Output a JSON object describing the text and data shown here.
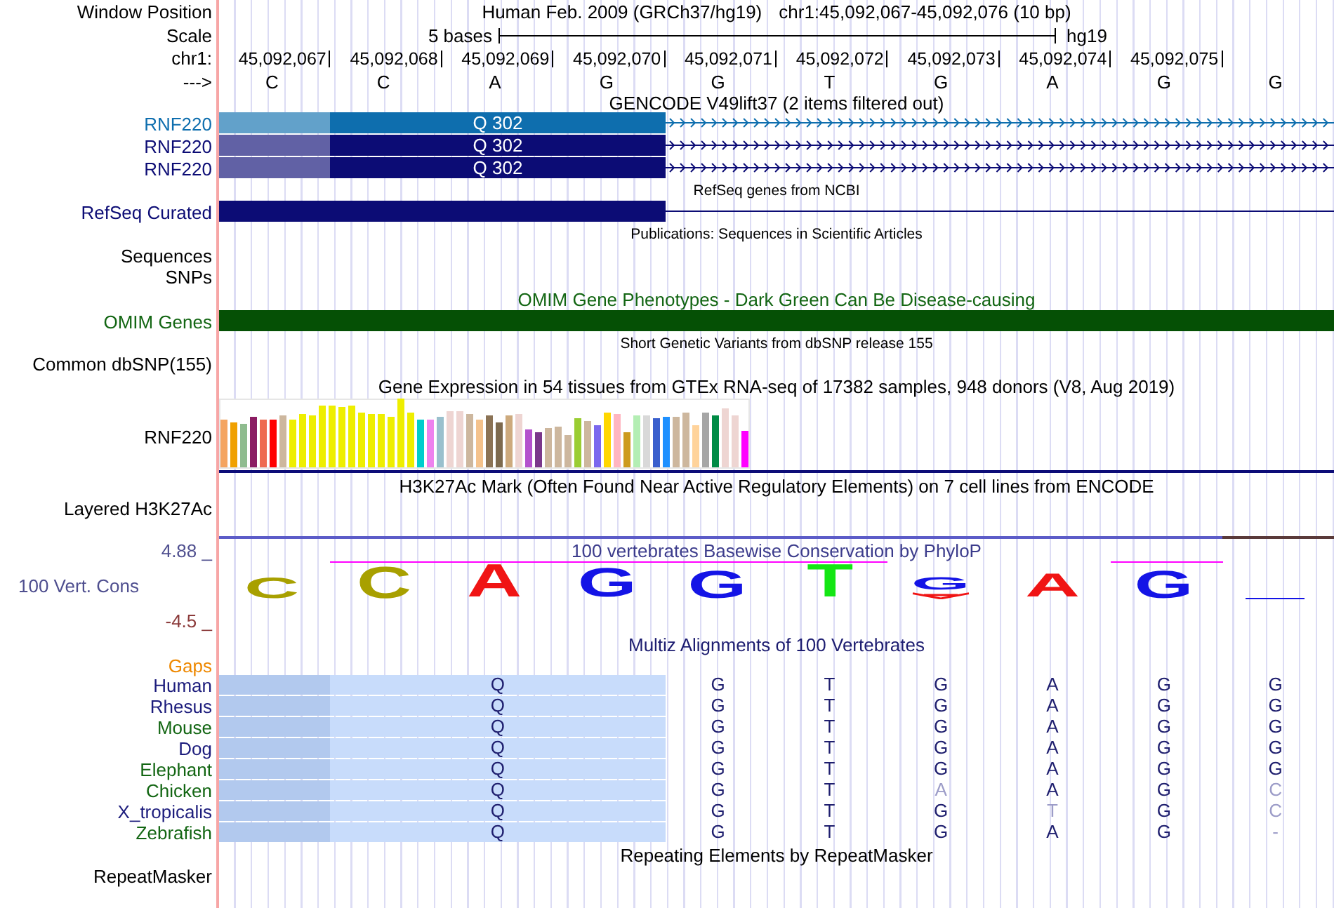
{
  "window_position": {
    "label": "Window Position",
    "assembly": "Human Feb. 2009 (GRCh37/hg19)",
    "position": "chr1:45,092,067-45,092,076 (10 bp)"
  },
  "scale": {
    "label": "Scale",
    "span": "5 bases",
    "assembly": "hg19"
  },
  "coordinates": {
    "label": "chr1:",
    "positions": [
      "45,092,067",
      "45,092,068",
      "45,092,069",
      "45,092,070",
      "45,092,071",
      "45,092,072",
      "45,092,073",
      "45,092,074",
      "45,092,075"
    ]
  },
  "sequence": {
    "label": "--->",
    "bases": [
      "C",
      "C",
      "A",
      "G",
      "G",
      "T",
      "G",
      "A",
      "G",
      "G"
    ]
  },
  "gencode": {
    "title": "GENCODE V49lift37 (2 items filtered out)",
    "rows": [
      {
        "label": "RNF220",
        "color": "#0e6eae",
        "codon": "Q 302"
      },
      {
        "label": "RNF220",
        "color": "#0c0c75",
        "codon": "Q 302"
      },
      {
        "label": "RNF220",
        "color": "#0c0c75",
        "codon": "Q 302"
      }
    ]
  },
  "refseq": {
    "title": "RefSeq genes from NCBI",
    "label": "RefSeq Curated",
    "color": "#0c0c75"
  },
  "publications": {
    "title": "Publications: Sequences in Scientific Articles",
    "subtracks": [
      "Sequences",
      "SNPs"
    ]
  },
  "omim": {
    "title": "OMIM Gene Phenotypes - Dark Green Can Be Disease-causing",
    "label": "OMIM Genes"
  },
  "dbsnp": {
    "title": "Short Genetic Variants from dbSNP release 155",
    "label": "Common dbSNP(155)"
  },
  "gtex": {
    "title": "Gene Expression in 54 tissues from GTEx RNA-seq of 17382 samples, 948 donors (V8, Aug 2019)",
    "label": "RNF220"
  },
  "h3k27ac": {
    "title": "H3K27Ac Mark (Often Found Near Active Regulatory Elements) on 7 cell lines from ENCODE",
    "label": "Layered H3K27Ac"
  },
  "conservation": {
    "title": "100 vertebrates Basewise Conservation by PhyloP",
    "label": "100 Vert. Cons",
    "max_label": "4.88 _",
    "min_label": "-4.5 _",
    "logo": [
      {
        "kind": "letter",
        "base": "C",
        "color": "#a8a000"
      },
      {
        "kind": "letter",
        "base": "C",
        "color": "#a8a000"
      },
      {
        "kind": "letter",
        "base": "A",
        "color": "#f01414"
      },
      {
        "kind": "letter",
        "base": "G",
        "color": "#1414e6"
      },
      {
        "kind": "letter",
        "base": "G",
        "color": "#1414e6"
      },
      {
        "kind": "letter",
        "base": "T",
        "color": "#14e614"
      },
      {
        "kind": "letter",
        "base": "G",
        "color": "#1414e6",
        "below": {
          "color": "#f01414"
        }
      },
      {
        "kind": "letter",
        "base": "A",
        "color": "#f01414"
      },
      {
        "kind": "letter",
        "base": "G",
        "color": "#1414e6"
      },
      {
        "kind": "dash",
        "color": "#1414e6"
      }
    ]
  },
  "multiz": {
    "title": "Multiz Alignments of 100 Vertebrates",
    "gaps_label": "Gaps",
    "species": [
      {
        "name": "Human",
        "color": "#1c1c7c",
        "codon": "Q",
        "bases": [
          {
            "base": "G",
            "match": true
          },
          {
            "base": "T",
            "match": true
          },
          {
            "base": "G",
            "match": true
          },
          {
            "base": "A",
            "match": true
          },
          {
            "base": "G",
            "match": true
          },
          {
            "base": "G",
            "match": true
          }
        ]
      },
      {
        "name": "Rhesus",
        "color": "#1c1c7c",
        "codon": "Q",
        "bases": [
          {
            "base": "G",
            "match": true
          },
          {
            "base": "T",
            "match": true
          },
          {
            "base": "G",
            "match": true
          },
          {
            "base": "A",
            "match": true
          },
          {
            "base": "G",
            "match": true
          },
          {
            "base": "G",
            "match": true
          }
        ]
      },
      {
        "name": "Mouse",
        "color": "#136613",
        "codon": "Q",
        "bases": [
          {
            "base": "G",
            "match": true
          },
          {
            "base": "T",
            "match": true
          },
          {
            "base": "G",
            "match": true
          },
          {
            "base": "A",
            "match": true
          },
          {
            "base": "G",
            "match": true
          },
          {
            "base": "G",
            "match": true
          }
        ]
      },
      {
        "name": "Dog",
        "color": "#1c1c7c",
        "codon": "Q",
        "bases": [
          {
            "base": "G",
            "match": true
          },
          {
            "base": "T",
            "match": true
          },
          {
            "base": "G",
            "match": true
          },
          {
            "base": "A",
            "match": true
          },
          {
            "base": "G",
            "match": true
          },
          {
            "base": "G",
            "match": true
          }
        ]
      },
      {
        "name": "Elephant",
        "color": "#136613",
        "codon": "Q",
        "bases": [
          {
            "base": "G",
            "match": true
          },
          {
            "base": "T",
            "match": true
          },
          {
            "base": "G",
            "match": true
          },
          {
            "base": "A",
            "match": true
          },
          {
            "base": "G",
            "match": true
          },
          {
            "base": "G",
            "match": true
          }
        ]
      },
      {
        "name": "Chicken",
        "color": "#136613",
        "codon": "Q",
        "bases": [
          {
            "base": "G",
            "match": true
          },
          {
            "base": "T",
            "match": true
          },
          {
            "base": "A",
            "match": false
          },
          {
            "base": "A",
            "match": true
          },
          {
            "base": "G",
            "match": true
          },
          {
            "base": "C",
            "match": false
          }
        ]
      },
      {
        "name": "X_tropicalis",
        "color": "#1c1c7c",
        "codon": "Q",
        "bases": [
          {
            "base": "G",
            "match": true
          },
          {
            "base": "T",
            "match": true
          },
          {
            "base": "G",
            "match": true
          },
          {
            "base": "T",
            "match": false
          },
          {
            "base": "G",
            "match": true
          },
          {
            "base": "C",
            "match": false
          }
        ]
      },
      {
        "name": "Zebrafish",
        "color": "#136613",
        "codon": "Q",
        "bases": [
          {
            "base": "G",
            "match": true
          },
          {
            "base": "T",
            "match": true
          },
          {
            "base": "G",
            "match": true
          },
          {
            "base": "A",
            "match": true
          },
          {
            "base": "G",
            "match": true
          },
          {
            "base": "-",
            "match": false
          }
        ]
      }
    ]
  },
  "repeatmasker": {
    "title": "Repeating Elements by RepeatMasker",
    "label": "RepeatMasker"
  }
}
